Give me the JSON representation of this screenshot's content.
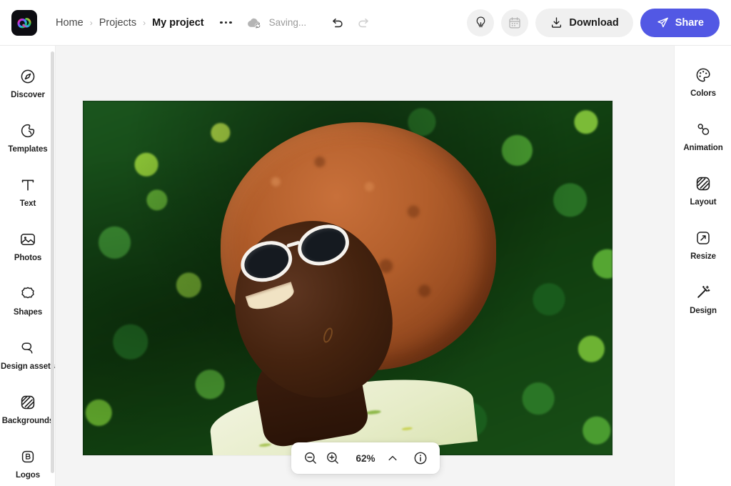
{
  "app": {
    "name": "Adobe Express",
    "logo_icon": "adobe-express-logo-icon",
    "logo_colors": [
      "#ff2d87",
      "#9c3cf0",
      "#2aa7ff",
      "#22c55e",
      "#ffb01f"
    ],
    "logo_background": "#0d0d12",
    "accent_color": "#5258e4",
    "canvas_background": "#f4f4f4"
  },
  "header": {
    "breadcrumb": {
      "items": [
        {
          "label": "Home",
          "current": false
        },
        {
          "label": "Projects",
          "current": false
        },
        {
          "label": "My project",
          "current": true
        }
      ],
      "separator": "›"
    },
    "more_options": {
      "icon": "more-options-icon",
      "label": "More options"
    },
    "sync": {
      "icon": "cloud-sync-icon",
      "status_text": "Saving..."
    },
    "history": {
      "undo": {
        "icon": "undo-icon",
        "label": "Undo",
        "enabled": true
      },
      "redo": {
        "icon": "redo-icon",
        "label": "Redo",
        "enabled": false
      }
    },
    "actions": {
      "ideas": {
        "icon": "lightbulb-icon",
        "label": "Ideas"
      },
      "schedule": {
        "icon": "calendar-icon",
        "label": "Schedule",
        "enabled": false
      },
      "download": {
        "icon": "download-icon",
        "label": "Download"
      },
      "share": {
        "icon": "share-send-icon",
        "label": "Share"
      }
    }
  },
  "left_rail": {
    "items": [
      {
        "label": "Discover",
        "icon": "compass-icon"
      },
      {
        "label": "Templates",
        "icon": "templates-icon"
      },
      {
        "label": "Text",
        "icon": "text-t-icon"
      },
      {
        "label": "Photos",
        "icon": "photo-icon"
      },
      {
        "label": "Shapes",
        "icon": "shapes-icon"
      },
      {
        "label": "Design assets",
        "icon": "design-assets-icon"
      },
      {
        "label": "Backgrounds",
        "icon": "backgrounds-icon"
      },
      {
        "label": "Logos",
        "icon": "logos-brand-icon"
      }
    ],
    "scrollbar": {
      "visible": true
    }
  },
  "right_rail": {
    "items": [
      {
        "label": "Colors",
        "icon": "palette-icon"
      },
      {
        "label": "Animation",
        "icon": "animation-nodes-icon"
      },
      {
        "label": "Layout",
        "icon": "layout-icon"
      },
      {
        "label": "Resize",
        "icon": "resize-icon"
      },
      {
        "label": "Design",
        "icon": "magic-wand-icon"
      }
    ]
  },
  "canvas": {
    "artwork": {
      "name": "portrait-photo",
      "description": "Smiling woman with auburn afro and white sunglasses in front of green foliage"
    }
  },
  "zoom_bar": {
    "zoom_out": {
      "icon": "zoom-out-icon",
      "label": "Zoom out"
    },
    "zoom_in": {
      "icon": "zoom-in-icon",
      "label": "Zoom in"
    },
    "level": "62%",
    "expand": {
      "icon": "chevron-up-icon",
      "label": "Zoom options"
    },
    "info": {
      "icon": "info-icon",
      "label": "Info"
    }
  }
}
